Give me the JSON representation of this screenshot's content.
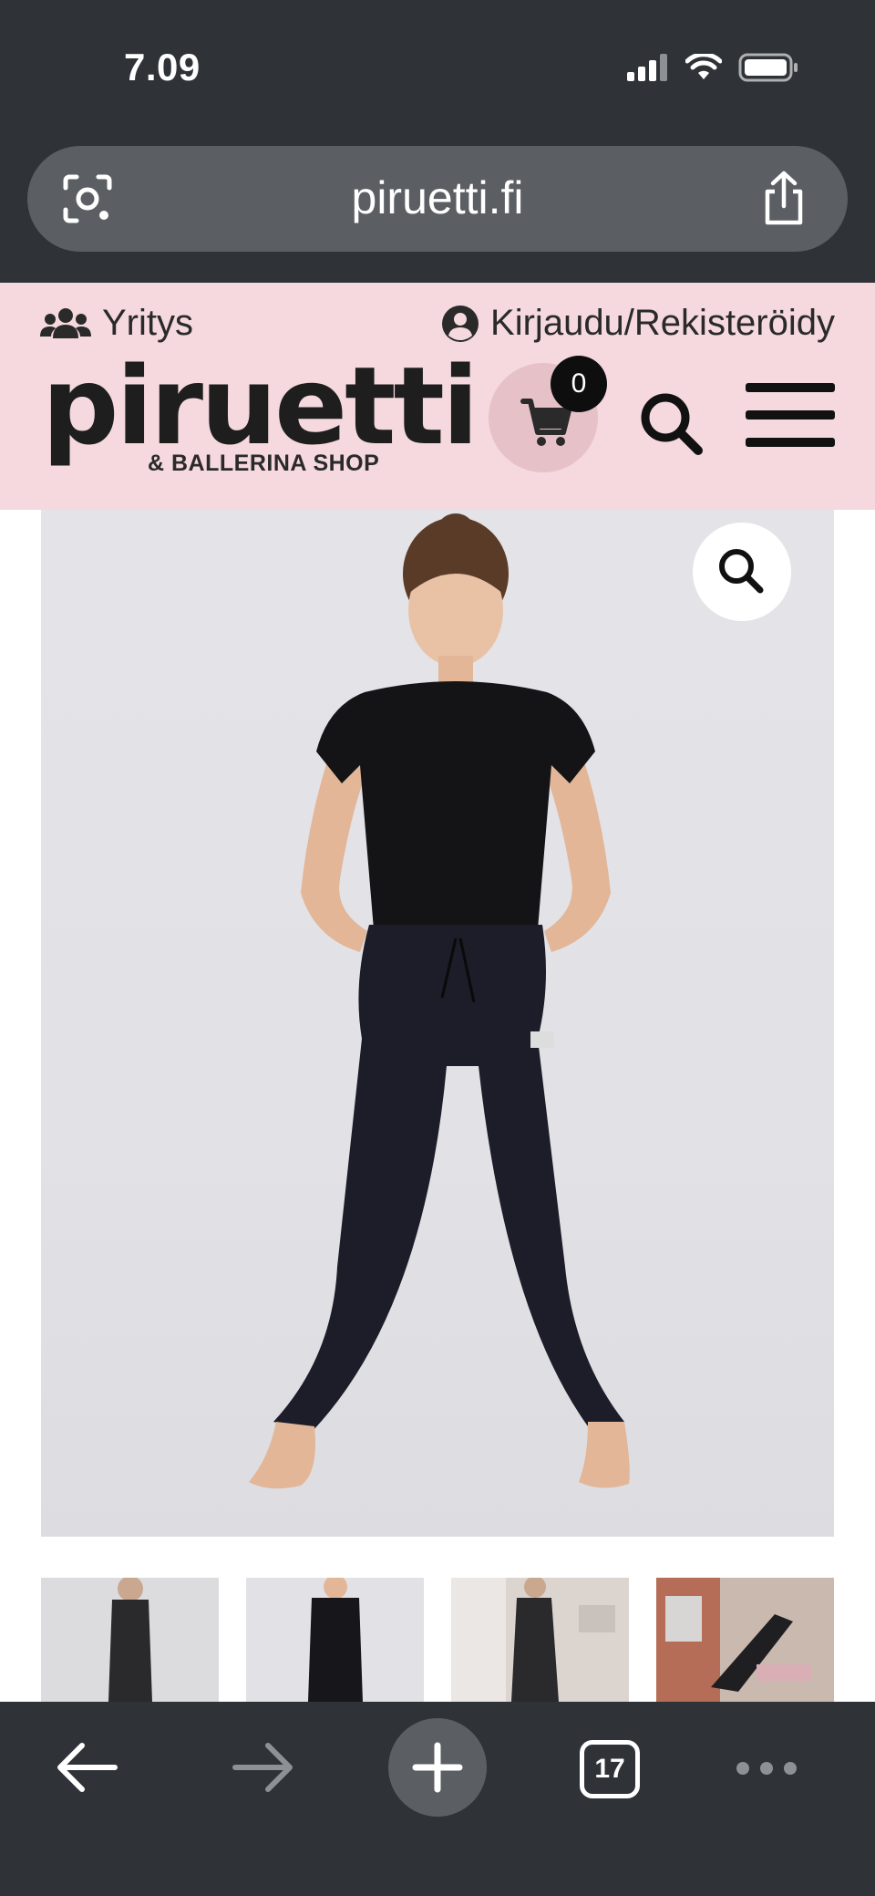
{
  "status_bar": {
    "time": "7.09"
  },
  "browser": {
    "url": "piruetti.fi",
    "open_tabs": "17"
  },
  "header": {
    "company_link": "Yritys",
    "login_link": "Kirjaudu/Rekisteröidy",
    "logo_text": "piruetti",
    "logo_tagline": "& BALLERINA SHOP",
    "cart_count": "0"
  },
  "colors": {
    "header_background": "#f5d9de",
    "cart_circle": "#e7c1c8",
    "browser_chrome": "#2f3236"
  },
  "icons": [
    "signal-icon",
    "wifi-icon",
    "battery-icon",
    "screen-search-icon",
    "share-icon",
    "users-icon",
    "user-circle-icon",
    "cart-icon",
    "search-icon",
    "hamburger-menu-icon",
    "zoom-icon",
    "back-arrow-icon",
    "forward-arrow-icon",
    "plus-icon",
    "tabs-icon",
    "more-dots-icon"
  ]
}
